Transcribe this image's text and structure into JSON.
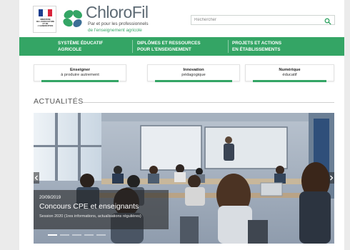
{
  "gov_logo": {
    "flag_colors": [
      "#1b3e8e",
      "#ffffff",
      "#d9243b"
    ],
    "text_lines": [
      "MINISTÈRE",
      "DE L'AGRICULTURE",
      "ET DE",
      "L'ALIMENTATION"
    ]
  },
  "brand": {
    "name": "ChloroFil",
    "tagline_line1": "Par et pour les professionnels",
    "tagline_line2": "de l'enseignement agricole",
    "logo_colors": [
      "#34a565",
      "#3d6f96"
    ]
  },
  "search": {
    "placeholder": "Rechercher",
    "icon": "search-icon"
  },
  "nav": {
    "background": "#34a565",
    "items": [
      {
        "line1": "SYSTÈME ÉDUCATIF",
        "line2": "AGRICOLE"
      },
      {
        "line1": "DIPLÔMES ET RESSOURCES",
        "line2": "POUR L'ENSEIGNEMENT"
      },
      {
        "line1": "PROJETS ET ACTIONS",
        "line2": "EN ÉTABLISSEMENTS"
      }
    ]
  },
  "cards": [
    {
      "title": "Enseigner",
      "subtitle": "à produire autrement"
    },
    {
      "title": "Innovation",
      "subtitle": "pédagogique"
    },
    {
      "title": "Numérique",
      "subtitle": "éducatif"
    }
  ],
  "news": {
    "heading": "ACTUALITÉS",
    "slide": {
      "date": "20/09/2019",
      "title": "Concours CPE et enseignants",
      "subtitle": "Session 2020 (1res informations, actualisations régulières)",
      "image_icon": "classroom-photo"
    },
    "slide_count": 5,
    "active_slide": 1,
    "prev_icon": "chevron-left-icon",
    "next_icon": "chevron-right-icon"
  }
}
